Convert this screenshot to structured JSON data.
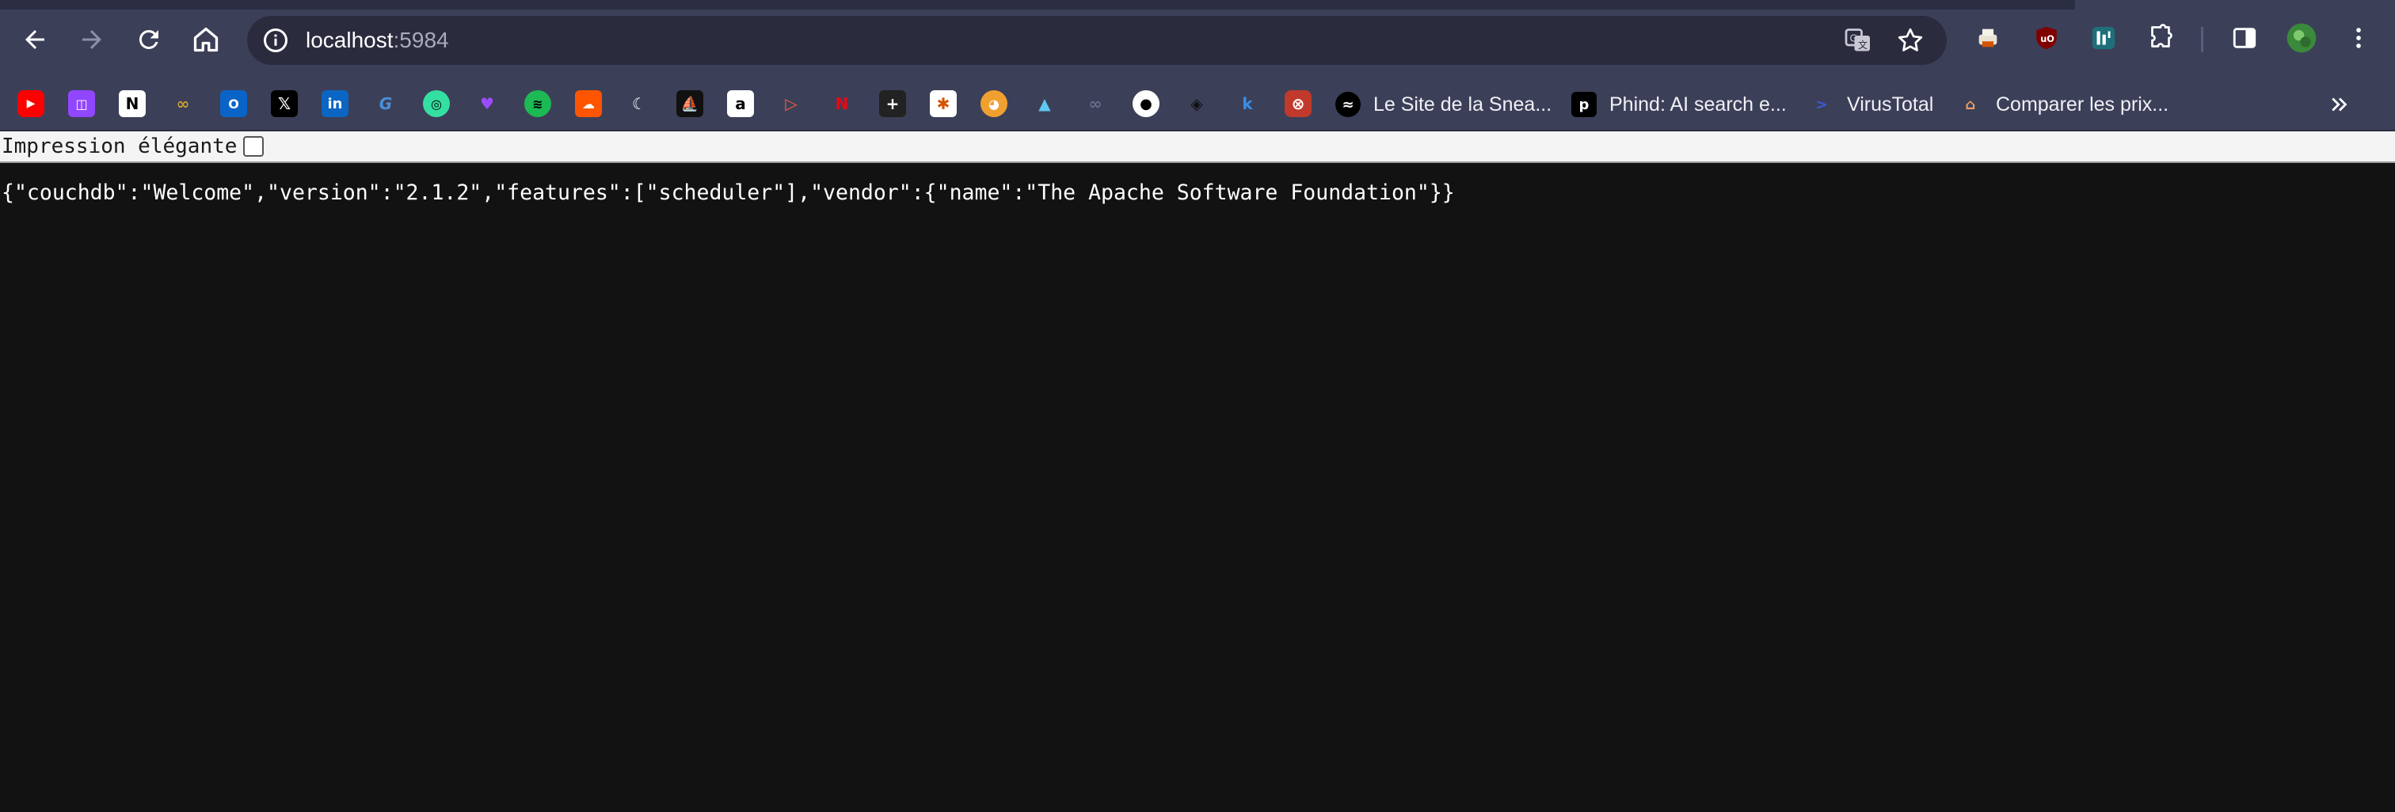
{
  "browser": {
    "url_host": "localhost",
    "url_port": ":5984"
  },
  "bookmarks": {
    "icons": [
      "youtube-icon",
      "twitch-icon",
      "notion-icon",
      "binoculars-icon",
      "outlook-icon",
      "x-icon",
      "linkedin-icon",
      "grammarly-icon",
      "tripadvisor-icon",
      "heart-icon",
      "spotify-icon",
      "soundcloud-icon",
      "moon-icon",
      "ship-icon",
      "amazon-icon",
      "play-icon",
      "netflix-icon",
      "plus-icon",
      "puzzle-icon",
      "fox-icon",
      "mountain-icon",
      "mask-icon",
      "github-icon",
      "layers-icon",
      "k-icon",
      "target-icon"
    ],
    "items": [
      {
        "label": "Le Site de la Snea...",
        "icon": "sneaker-icon"
      },
      {
        "label": "Phind: AI search e...",
        "icon": "phind-icon"
      },
      {
        "label": "VirusTotal",
        "icon": "virustotal-icon"
      },
      {
        "label": "Comparer les prix...",
        "icon": "bag-icon"
      }
    ]
  },
  "page": {
    "pretty_print_label": "Impression élégante",
    "json_body": "{\"couchdb\":\"Welcome\",\"version\":\"2.1.2\",\"features\":[\"scheduler\"],\"vendor\":{\"name\":\"The Apache Software Foundation\"}}"
  },
  "colors": {
    "toolbar": "#3c3f58",
    "page_background": "#121212"
  }
}
